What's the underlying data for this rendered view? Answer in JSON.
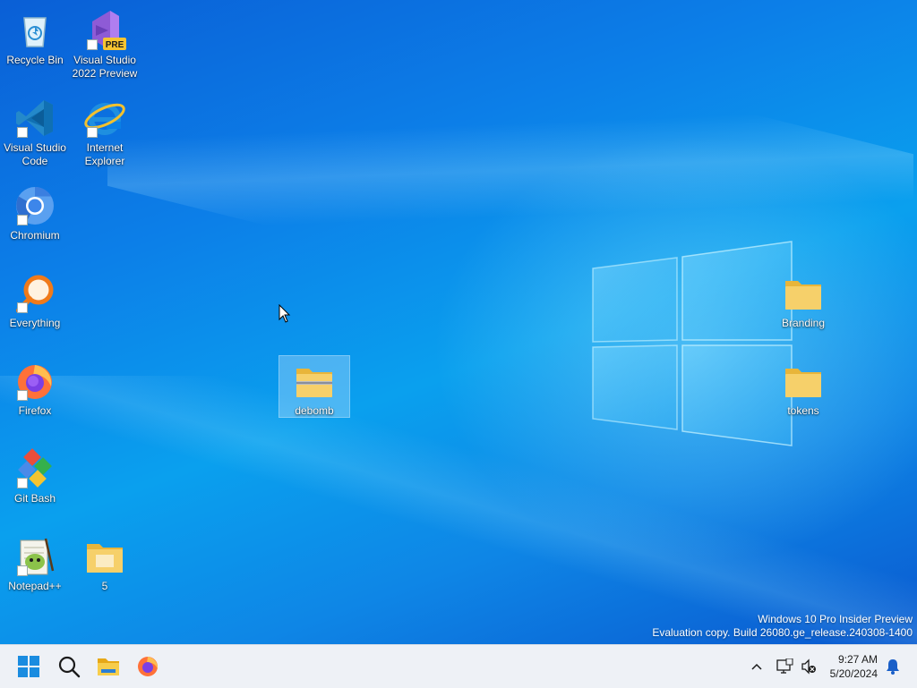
{
  "desktop": {
    "icons": [
      {
        "label": "Recycle Bin"
      },
      {
        "label": "Visual Studio 2022 Preview",
        "badge": "PRE"
      },
      {
        "label": "Visual Studio Code"
      },
      {
        "label": "Internet Explorer"
      },
      {
        "label": "Chromium"
      },
      {
        "label": "Everything"
      },
      {
        "label": "Firefox"
      },
      {
        "label": "Git Bash"
      },
      {
        "label": "Notepad++"
      },
      {
        "label": "5"
      },
      {
        "label": "debomb"
      },
      {
        "label": "Branding"
      },
      {
        "label": "tokens"
      }
    ],
    "watermark": {
      "line1": "Windows 10 Pro Insider Preview",
      "line2": "Evaluation copy. Build 26080.ge_release.240308-1400"
    }
  },
  "taskbar": {
    "pinned": [
      {
        "icon": "windows-start-icon"
      },
      {
        "icon": "search-icon"
      },
      {
        "icon": "file-explorer-icon"
      },
      {
        "icon": "firefox-icon"
      }
    ],
    "tray": {
      "overflow_icon": "chevron-up-icon",
      "network_icon": "network-icon",
      "volume_icon": "volume-muted-icon",
      "notification_icon": "bell-icon"
    },
    "clock": {
      "time": "9:27 AM",
      "date": "5/20/2024"
    }
  },
  "colors": {
    "desktop_blue": "#0a7fe6",
    "folder_yellow": "#f6c948",
    "taskbar_bg": "#eef1f6"
  }
}
